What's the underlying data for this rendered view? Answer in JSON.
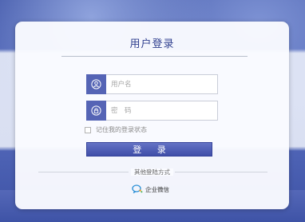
{
  "login": {
    "title": "用户登录",
    "username_placeholder": "用户名",
    "password_placeholder": "密　码",
    "remember_label": "记住我的登录状态",
    "login_button": "登 录",
    "other_methods_label": "其他登陆方式",
    "wecom_label": "企业微信"
  },
  "colors": {
    "accent": "#5564b5",
    "title": "#2f3f8f",
    "background": "#4c5fae"
  },
  "icons": {
    "username": "user-icon",
    "password": "lock-icon",
    "wecom": "wecom-icon"
  }
}
